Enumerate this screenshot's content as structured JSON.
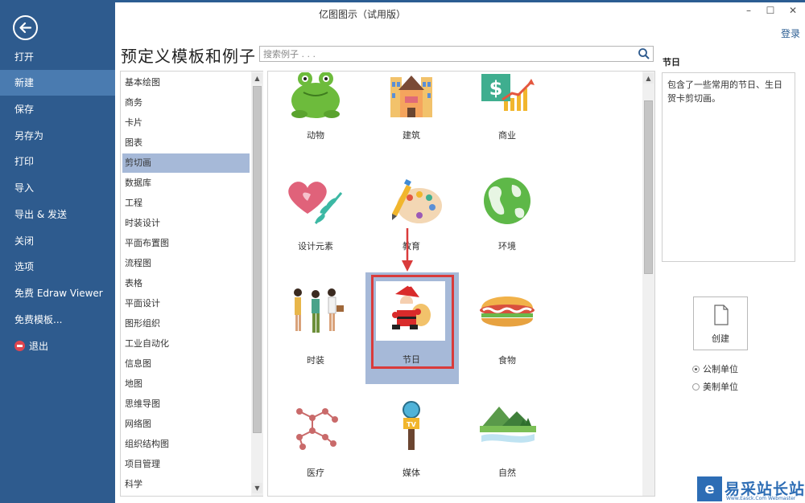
{
  "window": {
    "title": "亿图图示（试用版）",
    "minimize_icon": "–",
    "maximize_icon": "☐",
    "close_icon": "✕",
    "login_label": "登录"
  },
  "sidebar": {
    "items": [
      {
        "label": "打开"
      },
      {
        "label": "新建"
      },
      {
        "label": "保存"
      },
      {
        "label": "另存为"
      },
      {
        "label": "打印"
      },
      {
        "label": "导入"
      },
      {
        "label": "导出 & 发送"
      },
      {
        "label": "关闭"
      },
      {
        "label": "选项"
      },
      {
        "label": "免费 Edraw Viewer"
      },
      {
        "label": "免费模板..."
      },
      {
        "label": "退出"
      }
    ],
    "active_item": "新建"
  },
  "main": {
    "heading": "预定义模板和例子",
    "search_placeholder": "搜索例子 . . ."
  },
  "categories": {
    "items": [
      "基本绘图",
      "商务",
      "卡片",
      "图表",
      "剪切画",
      "数据库",
      "工程",
      "时装设计",
      "平面布置图",
      "流程图",
      "表格",
      "平面设计",
      "图形组织",
      "工业自动化",
      "信息图",
      "地图",
      "思维导图",
      "网络图",
      "组织结构图",
      "项目管理",
      "科学"
    ],
    "selected": "剪切画"
  },
  "gallery": {
    "tiles": [
      {
        "label": "动物",
        "icon": "frog-icon"
      },
      {
        "label": "建筑",
        "icon": "building-icon"
      },
      {
        "label": "商业",
        "icon": "business-chart-icon"
      },
      {
        "label": "设计元素",
        "icon": "heart-leaf-icon"
      },
      {
        "label": "教育",
        "icon": "palette-pencil-icon"
      },
      {
        "label": "环境",
        "icon": "globe-icon"
      },
      {
        "label": "时装",
        "icon": "fashion-people-icon"
      },
      {
        "label": "节日",
        "icon": "santa-icon"
      },
      {
        "label": "食物",
        "icon": "hamburger-icon"
      },
      {
        "label": "医疗",
        "icon": "molecule-icon"
      },
      {
        "label": "媒体",
        "icon": "microphone-tv-icon"
      },
      {
        "label": "自然",
        "icon": "mountain-landscape-icon"
      }
    ],
    "selected": "节日"
  },
  "details": {
    "title": "节日",
    "description": "包含了一些常用的节日、生日贺卡剪切画。",
    "create_label": "创建",
    "units": [
      {
        "label": "公制单位",
        "checked": true
      },
      {
        "label": "美制单位",
        "checked": false
      }
    ]
  },
  "watermark": {
    "logo_letter": "e",
    "text": "易采站长站",
    "subtext": "Www.Easck.Com  Webmaster"
  },
  "colors": {
    "sidebar": "#2e5b8e",
    "sidebar_active": "#4a7bb0",
    "selection": "#a6b9d8",
    "annotation_red": "#d93b3b"
  }
}
